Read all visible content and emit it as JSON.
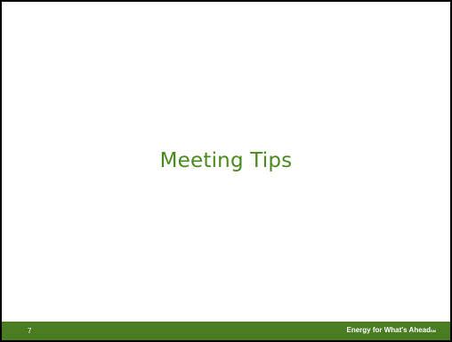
{
  "slide": {
    "title": "Meeting Tips",
    "page_number": "7",
    "tagline": "Energy for What's Ahead",
    "trademark": "SM"
  },
  "colors": {
    "title_text": "#4a8a1c",
    "footer_bar": "#4a7c22",
    "footer_text": "#ffffff",
    "frame_border": "#000000",
    "background": "#ffffff"
  }
}
